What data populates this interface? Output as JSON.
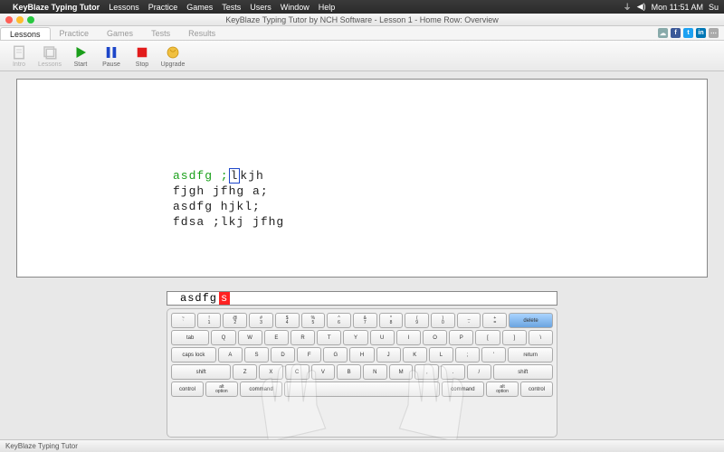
{
  "menubar": {
    "app": "KeyBlaze Typing Tutor",
    "items": [
      "Lessons",
      "Practice",
      "Games",
      "Tests",
      "Users",
      "Window",
      "Help"
    ],
    "status": {
      "wifi": "wifi",
      "vol": "♪",
      "clock": "Mon 11:51 AM",
      "user": "Su"
    }
  },
  "window": {
    "title": "KeyBlaze Typing Tutor by NCH Software - Lesson 1 - Home Row: Overview"
  },
  "tabs": {
    "items": [
      "Lessons",
      "Practice",
      "Games",
      "Tests",
      "Results"
    ],
    "active": 0
  },
  "toolbar": {
    "intro": "Intro",
    "lessons": "Lessons",
    "start": "Start",
    "pause": "Pause",
    "stop": "Stop",
    "upgrade": "Upgrade"
  },
  "lesson": {
    "typed": "asdfg ;",
    "current": "l",
    "rest1": "kjh",
    "line2": "fjgh jfhg a;",
    "line3": "asdfg hjkl;",
    "line4": "fdsa ;lkj jfhg"
  },
  "input": {
    "typed": "asdfg ",
    "error": "s"
  },
  "keyboard": {
    "row0": [
      "~\n`",
      "!\n1",
      "@\n2",
      "#\n3",
      "$\n4",
      "%\n5",
      "^\n6",
      "&\n7",
      "*\n8",
      "(\n9",
      ")\n0",
      "_\n-",
      "+\n="
    ],
    "delete": "delete",
    "tab": "tab",
    "row1": [
      "Q",
      "W",
      "E",
      "R",
      "T",
      "Y",
      "U",
      "I",
      "O",
      "P",
      "[",
      "]",
      "\\"
    ],
    "caps": "caps lock",
    "row2": [
      "A",
      "S",
      "D",
      "F",
      "G",
      "H",
      "J",
      "K",
      "L",
      ";",
      "'"
    ],
    "return": "return",
    "shift": "shift",
    "row3": [
      "Z",
      "X",
      "C",
      "V",
      "B",
      "N",
      "M",
      ",",
      ".",
      "/"
    ],
    "bottom": {
      "control": "control",
      "alt": "alt\noption",
      "cmd": "command"
    }
  },
  "statusbar": {
    "text": "KeyBlaze Typing Tutor"
  }
}
